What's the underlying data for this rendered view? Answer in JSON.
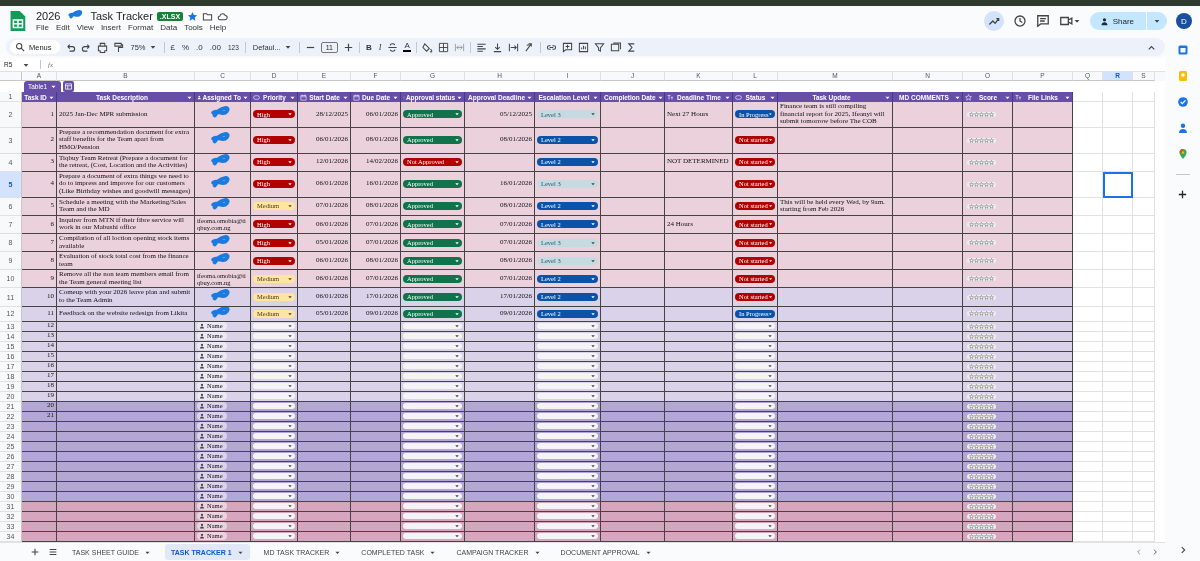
{
  "app_bar": {
    "title_start": "2026",
    "title_redacted": true,
    "title_end": "Task Tracker",
    "file_badge": ".XLSX",
    "starred": true,
    "menus": [
      "File",
      "Edit",
      "View",
      "Insert",
      "Format",
      "Data",
      "Tools",
      "Help"
    ],
    "share_label": "Share",
    "avatar": "D"
  },
  "toolbar": {
    "search_label": "Menus",
    "zoom": "75%",
    "currency": "£",
    "percent": "%",
    "decrease_decimals": ".0",
    "increase_decimals": ".00",
    "number_format": "123",
    "font": "Defaul...",
    "font_size": "11",
    "bold": "B",
    "italic": "I",
    "text_color": "A"
  },
  "formula_bar": {
    "cell_ref": "R5",
    "fx": "fx"
  },
  "grid": {
    "column_letters": [
      {
        "letter": "A",
        "selected": false
      },
      {
        "letter": "B",
        "selected": false
      },
      {
        "letter": "C",
        "selected": false
      },
      {
        "letter": "D",
        "selected": false
      },
      {
        "letter": "E",
        "selected": false
      },
      {
        "letter": "F",
        "selected": false
      },
      {
        "letter": "G",
        "selected": false
      },
      {
        "letter": "H",
        "selected": false
      },
      {
        "letter": "I",
        "selected": false
      },
      {
        "letter": "J",
        "selected": false
      },
      {
        "letter": "K",
        "selected": false
      },
      {
        "letter": "L",
        "selected": false
      },
      {
        "letter": "M",
        "selected": false
      },
      {
        "letter": "N",
        "selected": false
      },
      {
        "letter": "O",
        "selected": false
      },
      {
        "letter": "P",
        "selected": false
      },
      {
        "letter": "Q",
        "selected": false
      },
      {
        "letter": "R",
        "selected": true
      },
      {
        "letter": "S",
        "selected": false
      }
    ]
  },
  "table": {
    "name": "Table1",
    "header_row_number": "1",
    "columns": [
      {
        "label": "Task ID",
        "kind": "plain"
      },
      {
        "label": "Task Description",
        "kind": "plain"
      },
      {
        "label": "Assigned To",
        "kind": "person"
      },
      {
        "label": "Priority",
        "kind": "chip"
      },
      {
        "label": "Start Date",
        "kind": "date"
      },
      {
        "label": "Due Date",
        "kind": "date"
      },
      {
        "label": "Approval status",
        "kind": "chip"
      },
      {
        "label": "Approval Deadline",
        "kind": "date"
      },
      {
        "label": "Escalation Level",
        "kind": "plain"
      },
      {
        "label": "Completion Date",
        "kind": "date"
      },
      {
        "label": "Deadline Time",
        "kind": "text"
      },
      {
        "label": "Status",
        "kind": "chip"
      },
      {
        "label": "Task Update",
        "kind": "plain"
      },
      {
        "label": "MD COMMENTS",
        "kind": "plain"
      },
      {
        "label": "Score",
        "kind": "rating"
      },
      {
        "label": "File Links",
        "kind": "text"
      }
    ],
    "rows": [
      {
        "row_number": "2",
        "selected": false,
        "color": "#ead1dc",
        "task_id": "1",
        "description": "2025 Jan-Dec MPR submission",
        "assigned": {
          "redacted": true
        },
        "priority": {
          "label": "High",
          "color": "#b10202"
        },
        "start_date": "28/12/2025",
        "due_date": "06/01/2026",
        "approval_status": {
          "label": "Approved",
          "color": "#11734b"
        },
        "approval_deadline": "05/12/2025",
        "escalation_level": {
          "label": "Level 3",
          "color": "#c6dbe1"
        },
        "deadline_time": "Next 27 Hours",
        "status": {
          "label": "In Progress",
          "color": "#0a53a8"
        },
        "task_update": "Finance team is still compiling financial report for 2025, Ifeanyi will submit tomorrow before The COB",
        "score": {
          "stars": 0
        }
      },
      {
        "row_number": "3",
        "selected": false,
        "color": "#ead1dc",
        "task_id": "2",
        "description": "Prepare a recommendation document for extra staff benefits for the Team apart from HMO/Pension",
        "assigned": {
          "redacted": true
        },
        "priority": {
          "label": "High",
          "color": "#b10202"
        },
        "start_date": "06/01/2026",
        "due_date": "08/01/2026",
        "approval_status": {
          "label": "Approved",
          "color": "#11734b"
        },
        "approval_deadline": "08/01/2026",
        "escalation_level": {
          "label": "Level 2",
          "color": "#0a53a8"
        },
        "status": {
          "label": "Not started",
          "color": "#b10202"
        },
        "score": {
          "stars": 0
        }
      },
      {
        "row_number": "4",
        "selected": false,
        "color": "#ead1dc",
        "task_id": "3",
        "description": "Tiqbuy Team Retreat (Prepare a document for the retreat, (Cost, Location and the Activities)",
        "assigned": {
          "redacted": true
        },
        "priority": {
          "label": "High",
          "color": "#b10202"
        },
        "start_date": "12/01/2026",
        "due_date": "14/02/2026",
        "approval_status": {
          "label": "Not Approved",
          "color": "#b10202"
        },
        "escalation_level": {
          "label": "Level 2",
          "color": "#0a53a8"
        },
        "deadline_time": "NOT DETERMINED",
        "status": {
          "label": "Not started",
          "color": "#b10202"
        },
        "score": {
          "stars": 0
        }
      },
      {
        "row_number": "5",
        "selected": true,
        "color": "#ead1dc",
        "task_id": "4",
        "description": "Prepare a document of extra things we need to do to impress and improve for our customers (Like Birthday wishes and goodwill messages)",
        "assigned": {
          "redacted": true
        },
        "priority": {
          "label": "High",
          "color": "#b10202"
        },
        "start_date": "06/01/2026",
        "due_date": "16/01/2026",
        "approval_status": {
          "label": "Approved",
          "color": "#11734b"
        },
        "approval_deadline": "16/01/2026",
        "escalation_level": {
          "label": "Level 3",
          "color": "#c6dbe1"
        },
        "status": {
          "label": "Not started",
          "color": "#b10202"
        },
        "score": {
          "stars": 0
        }
      },
      {
        "row_number": "6",
        "selected": false,
        "color": "#ead1dc",
        "task_id": "5",
        "description": "Schedule a meeting with the Marketing/Sales Team and the MD",
        "assigned": {
          "redacted": true
        },
        "priority": {
          "label": "Medium",
          "color": "#ffe5a0"
        },
        "start_date": "07/01/2026",
        "due_date": "08/01/2026",
        "approval_status": {
          "label": "Approved",
          "color": "#11734b"
        },
        "approval_deadline": "08/01/2026",
        "escalation_level": {
          "label": "Level 2",
          "color": "#0a53a8"
        },
        "status": {
          "label": "Not started",
          "color": "#b10202"
        },
        "task_update": "This will be held every Wed, by 9am. starting from Feb 2026",
        "score": {
          "stars": 0
        }
      },
      {
        "row_number": "7",
        "selected": false,
        "color": "#ead1dc",
        "task_id": "6",
        "description": "Inquirer from MTN if their fibre service will work in our Mabushi office",
        "assigned": {
          "text": "ifeoma.omobia@tiqbuy.com.ng"
        },
        "priority": {
          "label": "High",
          "color": "#b10202"
        },
        "start_date": "06/01/2026",
        "due_date": "07/01/2026",
        "approval_status": {
          "label": "Approved",
          "color": "#11734b"
        },
        "approval_deadline": "07/01/2026",
        "escalation_level": {
          "label": "Level 2",
          "color": "#0a53a8"
        },
        "deadline_time": "24 Hours",
        "status": {
          "label": "Not started",
          "color": "#b10202"
        },
        "score": {
          "stars": 0
        }
      },
      {
        "row_number": "8",
        "selected": false,
        "color": "#ead1dc",
        "task_id": "7",
        "description": "Compilation of all loction opening stock items available",
        "assigned": {
          "redacted": true
        },
        "priority": {
          "label": "High",
          "color": "#b10202"
        },
        "start_date": "05/01/2026",
        "due_date": "07/01/2026",
        "approval_status": {
          "label": "Approved",
          "color": "#11734b"
        },
        "approval_deadline": "07/01/2026",
        "escalation_level": {
          "label": "Level 3",
          "color": "#c6dbe1"
        },
        "status": {
          "label": "Not started",
          "color": "#b10202"
        },
        "score": {
          "stars": 0
        }
      },
      {
        "row_number": "9",
        "selected": false,
        "color": "#ead1dc",
        "task_id": "8",
        "description": "Evaluation of stock total cost from the finance team",
        "assigned": {
          "redacted": true
        },
        "priority": {
          "label": "High",
          "color": "#b10202"
        },
        "start_date": "06/01/2026",
        "due_date": "08/01/2026",
        "approval_status": {
          "label": "Approved",
          "color": "#11734b"
        },
        "approval_deadline": "08/01/2026",
        "escalation_level": {
          "label": "Level 3",
          "color": "#c6dbe1"
        },
        "status": {
          "label": "Not started",
          "color": "#b10202"
        },
        "score": {
          "stars": 0
        }
      },
      {
        "row_number": "10",
        "selected": false,
        "color": "#ead1dc",
        "task_id": "9",
        "description": "Remove all the non team members email from the Team general meeting list",
        "assigned": {
          "text": "ifeoma.omobia@tiqbuy.com.ng"
        },
        "priority": {
          "label": "Medium",
          "color": "#ffe5a0"
        },
        "start_date": "06/01/2026",
        "due_date": "07/01/2026",
        "approval_status": {
          "label": "Approved",
          "color": "#11734b"
        },
        "approval_deadline": "07/01/2026",
        "escalation_level": {
          "label": "Level 2",
          "color": "#0a53a8"
        },
        "status": {
          "label": "Not started",
          "color": "#b10202"
        },
        "score": {
          "stars": 0
        }
      },
      {
        "row_number": "11",
        "selected": false,
        "color": "#d9d2e9",
        "task_id": "10",
        "description": "Comeup with your 2026 leave plan and submit to the Team Admin",
        "assigned": {
          "redacted": true
        },
        "priority": {
          "label": "Medium",
          "color": "#ffe5a0"
        },
        "start_date": "06/01/2026",
        "due_date": "17/01/2026",
        "approval_status": {
          "label": "Approved",
          "color": "#11734b"
        },
        "approval_deadline": "17/01/2026",
        "escalation_level": {
          "label": "Level 2",
          "color": "#0a53a8"
        },
        "status": {
          "label": "Not started",
          "color": "#b10202"
        },
        "score": {
          "stars": 0
        }
      },
      {
        "row_number": "12",
        "selected": false,
        "color": "#d9d2e9",
        "task_id": "11",
        "description": "Feedback on the website redesign from Likita",
        "assigned": {
          "redacted": true
        },
        "priority": {
          "label": "Medium",
          "color": "#ffe5a0"
        },
        "start_date": "05/01/2026",
        "due_date": "09/01/2026",
        "approval_status": {
          "label": "Approved",
          "color": "#11734b"
        },
        "approval_deadline": "09/01/2026",
        "escalation_level": {
          "label": "Level 2",
          "color": "#0a53a8"
        },
        "status": {
          "label": "In Progress",
          "color": "#0a53a8"
        },
        "score": {
          "stars": 0
        }
      },
      {
        "row_number": "13",
        "selected": false,
        "color": "#d9d2e9",
        "task_id": "12",
        "assigned": {
          "placeholder": "Name"
        },
        "priority": {
          "color": "#f4f4f6"
        },
        "approval_status": {
          "color": "#f4f4f6"
        },
        "escalation_level": {
          "color": "#f4f4f6"
        },
        "status": {
          "color": "#f4f4f6"
        },
        "score": {
          "stars": 0
        }
      },
      {
        "row_number": "14",
        "selected": false,
        "color": "#d9d2e9",
        "task_id": "13",
        "assigned": {
          "placeholder": "Name"
        },
        "priority": {
          "color": "#f4f4f6"
        },
        "approval_status": {
          "color": "#f4f4f6"
        },
        "escalation_level": {
          "color": "#f4f4f6"
        },
        "status": {
          "color": "#f4f4f6"
        },
        "score": {
          "stars": 0
        }
      },
      {
        "row_number": "15",
        "selected": false,
        "color": "#d9d2e9",
        "task_id": "14",
        "assigned": {
          "placeholder": "Name"
        },
        "priority": {
          "color": "#f4f4f6"
        },
        "approval_status": {
          "color": "#f4f4f6"
        },
        "escalation_level": {
          "color": "#f4f4f6"
        },
        "status": {
          "color": "#f4f4f6"
        },
        "score": {
          "stars": 0
        }
      },
      {
        "row_number": "16",
        "selected": false,
        "color": "#d9d2e9",
        "task_id": "15",
        "assigned": {
          "placeholder": "Name"
        },
        "priority": {
          "color": "#f4f4f6"
        },
        "approval_status": {
          "color": "#f4f4f6"
        },
        "escalation_level": {
          "color": "#f4f4f6"
        },
        "status": {
          "color": "#f4f4f6"
        },
        "score": {
          "stars": 0
        }
      },
      {
        "row_number": "17",
        "selected": false,
        "color": "#d9d2e9",
        "task_id": "16",
        "assigned": {
          "placeholder": "Name"
        },
        "priority": {
          "color": "#f4f4f6"
        },
        "approval_status": {
          "color": "#f4f4f6"
        },
        "escalation_level": {
          "color": "#f4f4f6"
        },
        "status": {
          "color": "#f4f4f6"
        },
        "score": {
          "stars": 0
        }
      },
      {
        "row_number": "18",
        "selected": false,
        "color": "#d9d2e9",
        "task_id": "17",
        "assigned": {
          "placeholder": "Name"
        },
        "priority": {
          "color": "#f4f4f6"
        },
        "approval_status": {
          "color": "#f4f4f6"
        },
        "escalation_level": {
          "color": "#f4f4f6"
        },
        "status": {
          "color": "#f4f4f6"
        },
        "score": {
          "stars": 0
        }
      },
      {
        "row_number": "19",
        "selected": false,
        "color": "#d9d2e9",
        "task_id": "18",
        "assigned": {
          "placeholder": "Name"
        },
        "priority": {
          "color": "#f4f4f6"
        },
        "approval_status": {
          "color": "#f4f4f6"
        },
        "escalation_level": {
          "color": "#f4f4f6"
        },
        "status": {
          "color": "#f4f4f6"
        },
        "score": {
          "stars": 0
        }
      },
      {
        "row_number": "20",
        "selected": false,
        "color": "#d9d2e9",
        "task_id": "19",
        "assigned": {
          "placeholder": "Name"
        },
        "priority": {
          "color": "#f4f4f6"
        },
        "approval_status": {
          "color": "#f4f4f6"
        },
        "escalation_level": {
          "color": "#f4f4f6"
        },
        "status": {
          "color": "#f4f4f6"
        },
        "score": {
          "stars": 0
        }
      },
      {
        "row_number": "21",
        "selected": false,
        "color": "#b4a7d6",
        "task_id": "20",
        "assigned": {
          "placeholder": "Name"
        },
        "priority": {
          "color": "#f4f4f6"
        },
        "approval_status": {
          "color": "#f4f4f6"
        },
        "escalation_level": {
          "color": "#f4f4f6"
        },
        "status": {
          "color": "#f4f4f6"
        },
        "score": {
          "stars": 0
        }
      },
      {
        "row_number": "22",
        "selected": false,
        "color": "#b4a7d6",
        "task_id": "21",
        "assigned": {
          "placeholder": "Name"
        },
        "priority": {
          "color": "#f4f4f6"
        },
        "approval_status": {
          "color": "#f4f4f6"
        },
        "escalation_level": {
          "color": "#f4f4f6"
        },
        "status": {
          "color": "#f4f4f6"
        },
        "score": {
          "stars": 0
        }
      },
      {
        "row_number": "23",
        "selected": false,
        "color": "#b4a7d6",
        "assigned": {
          "placeholder": "Name"
        },
        "priority": {
          "color": "#f4f4f6"
        },
        "approval_status": {
          "color": "#f4f4f6"
        },
        "escalation_level": {
          "color": "#f4f4f6"
        },
        "status": {
          "color": "#f4f4f6"
        },
        "score": {
          "stars": 0
        }
      },
      {
        "row_number": "24",
        "selected": false,
        "color": "#b4a7d6",
        "assigned": {
          "placeholder": "Name"
        },
        "priority": {
          "color": "#f4f4f6"
        },
        "approval_status": {
          "color": "#f4f4f6"
        },
        "escalation_level": {
          "color": "#f4f4f6"
        },
        "status": {
          "color": "#f4f4f6"
        },
        "score": {
          "stars": 0
        }
      },
      {
        "row_number": "25",
        "selected": false,
        "color": "#b4a7d6",
        "assigned": {
          "placeholder": "Name"
        },
        "priority": {
          "color": "#f4f4f6"
        },
        "approval_status": {
          "color": "#f4f4f6"
        },
        "escalation_level": {
          "color": "#f4f4f6"
        },
        "status": {
          "color": "#f4f4f6"
        },
        "score": {
          "stars": 0
        }
      },
      {
        "row_number": "26",
        "selected": false,
        "color": "#b4a7d6",
        "assigned": {
          "placeholder": "Name"
        },
        "priority": {
          "color": "#f4f4f6"
        },
        "approval_status": {
          "color": "#f4f4f6"
        },
        "escalation_level": {
          "color": "#f4f4f6"
        },
        "status": {
          "color": "#f4f4f6"
        },
        "score": {
          "stars": 0
        }
      },
      {
        "row_number": "27",
        "selected": false,
        "color": "#b4a7d6",
        "assigned": {
          "placeholder": "Name"
        },
        "priority": {
          "color": "#f4f4f6"
        },
        "approval_status": {
          "color": "#f4f4f6"
        },
        "escalation_level": {
          "color": "#f4f4f6"
        },
        "status": {
          "color": "#f4f4f6"
        },
        "score": {
          "stars": 0
        }
      },
      {
        "row_number": "28",
        "selected": false,
        "color": "#b4a7d6",
        "assigned": {
          "placeholder": "Name"
        },
        "priority": {
          "color": "#f4f4f6"
        },
        "approval_status": {
          "color": "#f4f4f6"
        },
        "escalation_level": {
          "color": "#f4f4f6"
        },
        "status": {
          "color": "#f4f4f6"
        },
        "score": {
          "stars": 0
        }
      },
      {
        "row_number": "29",
        "selected": false,
        "color": "#b4a7d6",
        "assigned": {
          "placeholder": "Name"
        },
        "priority": {
          "color": "#f4f4f6"
        },
        "approval_status": {
          "color": "#f4f4f6"
        },
        "escalation_level": {
          "color": "#f4f4f6"
        },
        "status": {
          "color": "#f4f4f6"
        },
        "score": {
          "stars": 0
        }
      },
      {
        "row_number": "30",
        "selected": false,
        "color": "#b4a7d6",
        "assigned": {
          "placeholder": "Name"
        },
        "priority": {
          "color": "#f4f4f6"
        },
        "approval_status": {
          "color": "#f4f4f6"
        },
        "escalation_level": {
          "color": "#f4f4f6"
        },
        "status": {
          "color": "#f4f4f6"
        },
        "score": {
          "stars": 0
        }
      },
      {
        "row_number": "31",
        "selected": false,
        "color": "#d5a6bd",
        "assigned": {
          "placeholder": "Name"
        },
        "priority": {
          "color": "#f4f4f6"
        },
        "approval_status": {
          "color": "#f4f4f6"
        },
        "escalation_level": {
          "color": "#f4f4f6"
        },
        "status": {
          "color": "#f4f4f6"
        },
        "score": {
          "stars": 0
        }
      },
      {
        "row_number": "32",
        "selected": false,
        "color": "#d5a6bd",
        "assigned": {
          "placeholder": "Name"
        },
        "priority": {
          "color": "#f4f4f6"
        },
        "approval_status": {
          "color": "#f4f4f6"
        },
        "escalation_level": {
          "color": "#f4f4f6"
        },
        "status": {
          "color": "#f4f4f6"
        },
        "score": {
          "stars": 0
        }
      },
      {
        "row_number": "33",
        "selected": false,
        "color": "#d5a6bd",
        "assigned": {
          "placeholder": "Name"
        },
        "priority": {
          "color": "#f4f4f6"
        },
        "approval_status": {
          "color": "#f4f4f6"
        },
        "escalation_level": {
          "color": "#f4f4f6"
        },
        "status": {
          "color": "#f4f4f6"
        },
        "score": {
          "stars": 0
        }
      },
      {
        "row_number": "34",
        "selected": false,
        "color": "#d5a6bd",
        "assigned": {
          "placeholder": "Name"
        },
        "priority": {
          "color": "#f4f4f6"
        },
        "approval_status": {
          "color": "#f4f4f6"
        },
        "escalation_level": {
          "color": "#f4f4f6"
        },
        "status": {
          "color": "#f4f4f6"
        },
        "score": {
          "stars": 0
        }
      }
    ]
  },
  "sheet_tabs": [
    {
      "label": "TASK SHEET GUIDE",
      "selected": false
    },
    {
      "label": "TASK TRACKER 1",
      "selected": true
    },
    {
      "label": "MD TASK TRACKER",
      "selected": false
    },
    {
      "label": "COMPLETED TASK",
      "selected": false
    },
    {
      "label": "CAMPAIGN TRACKER",
      "selected": false
    },
    {
      "label": "DOCUMENT APPROVAL",
      "selected": false
    }
  ]
}
